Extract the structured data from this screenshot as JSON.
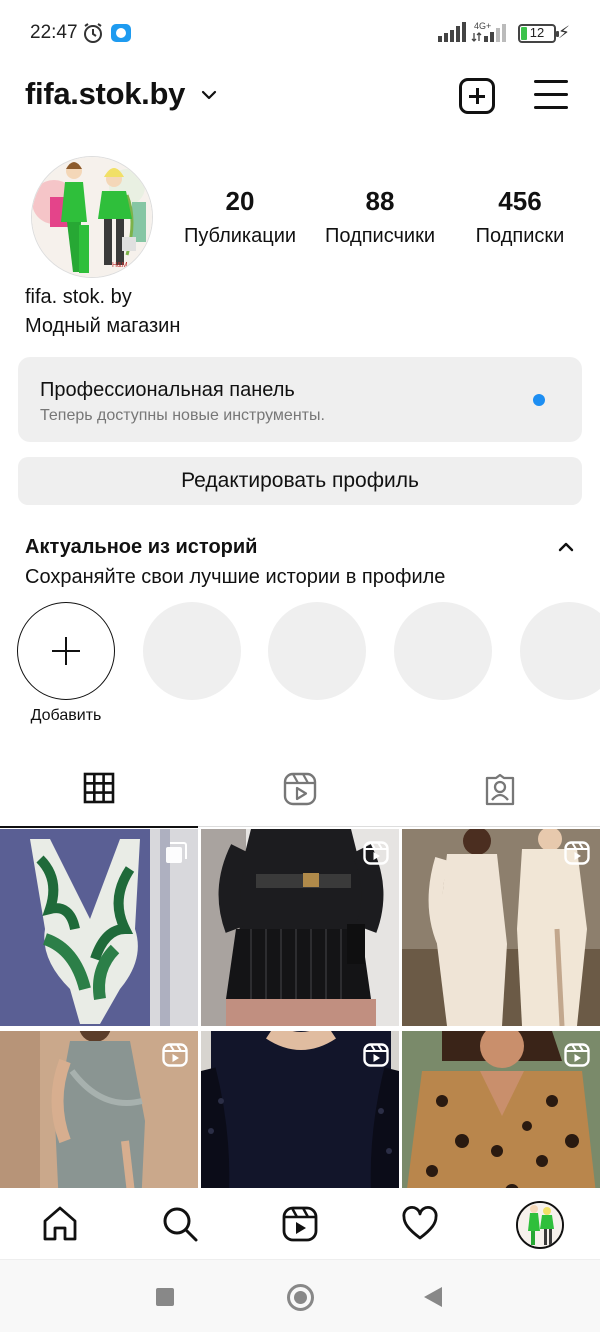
{
  "status_bar": {
    "time": "22:47",
    "network_label": "4G+",
    "battery": "12",
    "icons": [
      "alarm-icon",
      "app-notification-icon",
      "signal-icon",
      "network-icon",
      "battery-icon",
      "charging-icon"
    ]
  },
  "header": {
    "username": "fifa.stok.by",
    "icons": [
      "chevron-down-icon",
      "new-post-icon",
      "menu-icon"
    ]
  },
  "profile": {
    "stats": [
      {
        "value": "20",
        "label": "Публикации"
      },
      {
        "value": "88",
        "label": "Подписчики"
      },
      {
        "value": "456",
        "label": "Подписки"
      }
    ],
    "display_name": "fifa. stok. by",
    "bio": "Модный магазин"
  },
  "pro_panel": {
    "title": "Профессиональная панель",
    "subtitle": "Теперь доступны новые инструменты."
  },
  "edit_profile_label": "Редактировать профиль",
  "highlights": {
    "title": "Актуальное из историй",
    "subtitle": "Сохраняйте свои лучшие истории в профиле",
    "add_label": "Добавить"
  },
  "tabs": [
    "grid-icon",
    "reels-icon",
    "tagged-icon"
  ],
  "grid": {
    "posts": [
      {
        "badge": "multi-photo-icon"
      },
      {
        "badge": "reel-icon"
      },
      {
        "badge": "reel-icon"
      },
      {
        "badge": "reel-icon"
      },
      {
        "badge": "reel-icon"
      },
      {
        "badge": "reel-icon"
      }
    ]
  },
  "bottom_nav": [
    "home-icon",
    "search-icon",
    "reels-icon",
    "heart-icon",
    "profile-avatar"
  ],
  "colors": {
    "accent_blue": "#1d8ef2",
    "panel_bg": "#efefef",
    "text": "#111111"
  }
}
